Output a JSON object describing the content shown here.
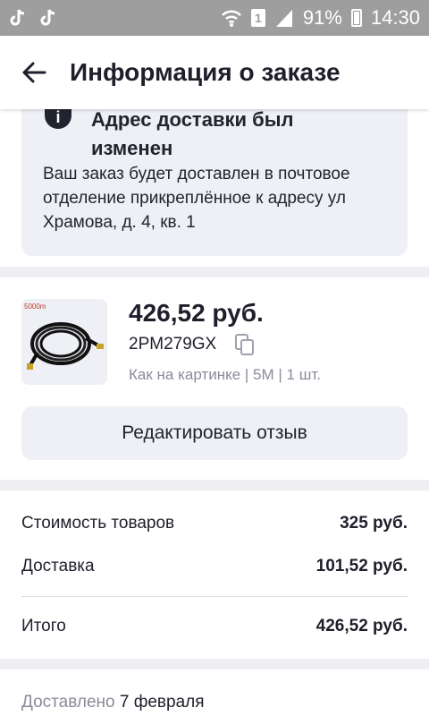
{
  "status_bar": {
    "battery": "91%",
    "time": "14:30",
    "sim_label": "1"
  },
  "header": {
    "title": "Информация о заказе"
  },
  "notice": {
    "title": "Адрес доставки был изменен",
    "text": "Ваш заказ будет доставлен в почтовое отделение прикреплённое к адресу ул Храмова, д. 4, кв. 1"
  },
  "product": {
    "image_label": "5000m",
    "price": "426,52 руб.",
    "code": "2PM279GX",
    "variant": "Как на картинке | 5M | 1 шт.",
    "edit_review_label": "Редактировать отзыв"
  },
  "summary": {
    "items_cost_label": "Стоимость товаров",
    "items_cost_value": "325 руб.",
    "delivery_label": "Доставка",
    "delivery_value": "101,52 руб.",
    "total_label": "Итого",
    "total_value": "426,52 руб."
  },
  "delivery": {
    "status_label": "Доставлено",
    "date": "7 февраля"
  },
  "colors": {
    "background": "#eeeef3",
    "card": "#ffffff",
    "muted_text": "#8a8b99",
    "status_bar": "#9e9e9e"
  }
}
